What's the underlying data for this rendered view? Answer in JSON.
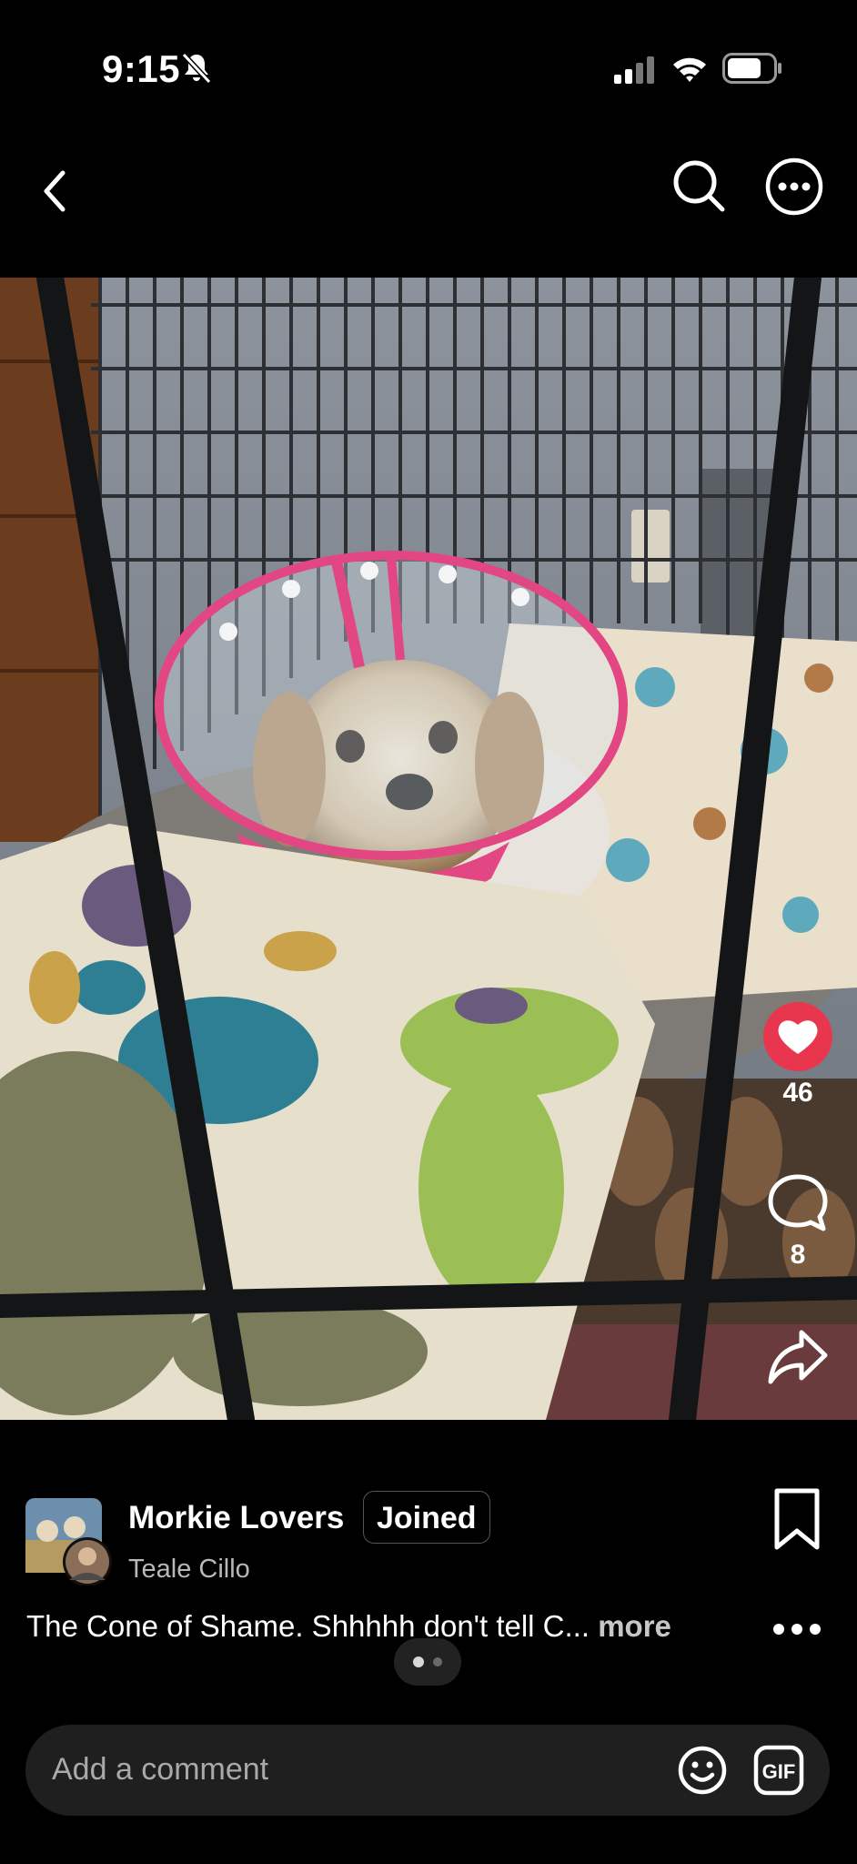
{
  "status": {
    "time": "9:15"
  },
  "post": {
    "likes": "46",
    "comments": "8",
    "group_name": "Morkie Lovers",
    "joined_label": "Joined",
    "author": "Teale Cillo",
    "caption": "The Cone of Shame.  Shhhhh don't tell C...",
    "more_label": "more"
  },
  "carousel": {
    "current_page": 1,
    "total_pages": 2
  },
  "comment_bar": {
    "placeholder": "Add a comment",
    "gif_label": "GIF"
  },
  "icons": {
    "back": "chevron-left-icon",
    "search": "search-icon",
    "more": "more-circle-icon",
    "like": "heart-icon",
    "comment": "comment-bubble-icon",
    "share": "share-arrow-icon",
    "bookmark": "bookmark-icon",
    "emoji": "smiley-icon",
    "gif": "gif-icon"
  },
  "colors": {
    "like_active": "#e8364f",
    "background": "#000000",
    "input_bg": "#1f1f1f"
  }
}
